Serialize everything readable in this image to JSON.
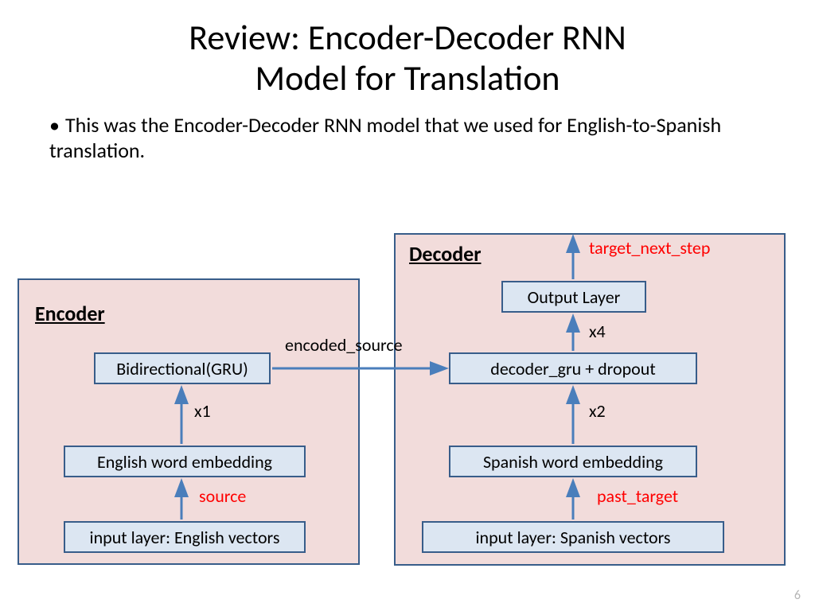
{
  "title_l1": "Review: Encoder-Decoder RNN",
  "title_l2": "Model for Translation",
  "bullet": "This was the Encoder-Decoder RNN model that we used for English-to-Spanish translation.",
  "encoder": {
    "label": "Encoder",
    "box_top": "Bidirectional(GRU)",
    "box_mid": "English word embedding",
    "box_bot": "input layer: English vectors",
    "arrow1": "x1",
    "arrow_bot": "source"
  },
  "decoder": {
    "label": "Decoder",
    "box_out": "Output Layer",
    "box_gru": "decoder_gru + dropout",
    "box_mid": "Spanish word embedding",
    "box_bot": "input layer: Spanish vectors",
    "arrow_top": "target_next_step",
    "arrow_x4": "x4",
    "arrow_x2": "x2",
    "arrow_bot": "past_target"
  },
  "mid_arrow": "encoded_source",
  "page": "6"
}
